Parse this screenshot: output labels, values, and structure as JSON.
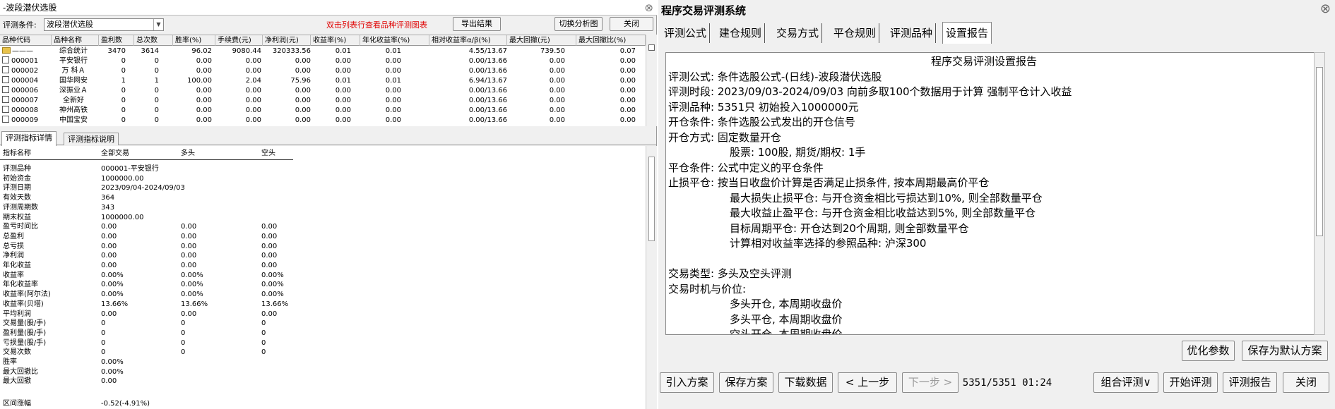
{
  "left": {
    "title": "-波段潜伏选股",
    "cond_label": "评测条件:",
    "cond_value": "波段潜伏选股",
    "hint": "双击列表行查看品种评测图表",
    "export_btn": "导出结果",
    "switch_btn": "切换分析图",
    "close_btn": "关闭",
    "columns": [
      "品种代码",
      "品种名称",
      "盈利数",
      "总次数",
      "胜率(%)",
      "手续费(元)",
      "净利润(元)",
      "收益率(%)",
      "年化收益率(%)",
      "相对收益率α/β(%)",
      "最大回撤(元)",
      "最大回撤比(%)"
    ],
    "rows": [
      {
        "code": "———",
        "name": "综合统计",
        "win": "3470",
        "total": "3614",
        "rate": "96.02",
        "fee": "9080.44",
        "profit": "320333.56",
        "ret": "0.01",
        "annual": "0.01",
        "rel": "4.55/13.67",
        "dd": "739.50",
        "ddr": "0.07"
      },
      {
        "code": "000001",
        "name": "平安银行",
        "win": "0",
        "total": "0",
        "rate": "0.00",
        "fee": "0.00",
        "profit": "0.00",
        "ret": "0.00",
        "annual": "0.00",
        "rel": "0.00/13.66",
        "dd": "0.00",
        "ddr": "0.00"
      },
      {
        "code": "000002",
        "name": "万 科Ａ",
        "win": "0",
        "total": "0",
        "rate": "0.00",
        "fee": "0.00",
        "profit": "0.00",
        "ret": "0.00",
        "annual": "0.00",
        "rel": "0.00/13.66",
        "dd": "0.00",
        "ddr": "0.00"
      },
      {
        "code": "000004",
        "name": "国华网安",
        "win": "1",
        "total": "1",
        "rate": "100.00",
        "fee": "2.04",
        "profit": "75.96",
        "ret": "0.01",
        "annual": "0.01",
        "rel": "6.94/13.67",
        "dd": "0.00",
        "ddr": "0.00"
      },
      {
        "code": "000006",
        "name": "深振业Ａ",
        "win": "0",
        "total": "0",
        "rate": "0.00",
        "fee": "0.00",
        "profit": "0.00",
        "ret": "0.00",
        "annual": "0.00",
        "rel": "0.00/13.66",
        "dd": "0.00",
        "ddr": "0.00"
      },
      {
        "code": "000007",
        "name": "全新好",
        "win": "0",
        "total": "0",
        "rate": "0.00",
        "fee": "0.00",
        "profit": "0.00",
        "ret": "0.00",
        "annual": "0.00",
        "rel": "0.00/13.66",
        "dd": "0.00",
        "ddr": "0.00"
      },
      {
        "code": "000008",
        "name": "神州高铁",
        "win": "0",
        "total": "0",
        "rate": "0.00",
        "fee": "0.00",
        "profit": "0.00",
        "ret": "0.00",
        "annual": "0.00",
        "rel": "0.00/13.66",
        "dd": "0.00",
        "ddr": "0.00"
      },
      {
        "code": "000009",
        "name": "中国宝安",
        "win": "0",
        "total": "0",
        "rate": "0.00",
        "fee": "0.00",
        "profit": "0.00",
        "ret": "0.00",
        "annual": "0.00",
        "rel": "0.00/13.66",
        "dd": "0.00",
        "ddr": "0.00"
      }
    ],
    "bottom_tabs": [
      "评测指标详情",
      "评测指标说明"
    ],
    "stats_header": [
      "指标名称",
      "全部交易",
      "多头",
      "空头"
    ],
    "stats": [
      [
        "评测品种",
        "000001-平安银行",
        "",
        ""
      ],
      [
        "初始资金",
        "1000000.00",
        "",
        ""
      ],
      [
        "评测日期",
        "2023/09/04-2024/09/03",
        "",
        ""
      ],
      [
        "有效天数",
        "364",
        "",
        ""
      ],
      [
        "评测周期数",
        "343",
        "",
        ""
      ],
      [
        "期末权益",
        "1000000.00",
        "",
        ""
      ],
      [
        "盈亏时间比",
        "0.00",
        "0.00",
        "0.00"
      ],
      [
        "总盈利",
        "0.00",
        "0.00",
        "0.00"
      ],
      [
        "总亏损",
        "0.00",
        "0.00",
        "0.00"
      ],
      [
        "净利润",
        "0.00",
        "0.00",
        "0.00"
      ],
      [
        "年化收益",
        "0.00",
        "0.00",
        "0.00"
      ],
      [
        "收益率",
        "0.00%",
        "0.00%",
        "0.00%"
      ],
      [
        "年化收益率",
        "0.00%",
        "0.00%",
        "0.00%"
      ],
      [
        "收益率(阿尔法)",
        "0.00%",
        "0.00%",
        "0.00%"
      ],
      [
        "收益率(贝塔)",
        "13.66%",
        "13.66%",
        "13.66%"
      ],
      [
        "平均利润",
        "0.00",
        "0.00",
        "0.00"
      ],
      [
        "交易量(股/手)",
        "0",
        "0",
        "0"
      ],
      [
        "盈利量(股/手)",
        "0",
        "0",
        "0"
      ],
      [
        "亏损量(股/手)",
        "0",
        "0",
        "0"
      ],
      [
        "交易次数",
        "0",
        "0",
        "0"
      ],
      [
        "胜率",
        "0.00%",
        "",
        ""
      ],
      [
        "最大回撤比",
        "0.00%",
        "",
        ""
      ],
      [
        "最大回撤",
        "0.00",
        "",
        ""
      ],
      [
        "",
        "",
        " ",
        ""
      ],
      [
        "区间涨幅",
        "-0.52(-4.91%)",
        "",
        ""
      ]
    ]
  },
  "right": {
    "title": "程序交易评测系统",
    "tabs": [
      "评测公式",
      "建仓规则",
      "交易方式",
      "平仓规则",
      "评测品种",
      "设置报告"
    ],
    "report": [
      {
        "t": "程序交易评测设置报告",
        "center": true
      },
      {
        "t": "评测公式: 条件选股公式-(日线)-波段潜伏选股"
      },
      {
        "t": "评测时段: 2023/09/03-2024/09/03 向前多取100个数据用于计算 强制平仓计入收益"
      },
      {
        "t": "评测品种: 5351只  初始投入1000000元"
      },
      {
        "t": "开仓条件: 条件选股公式发出的开仓信号"
      },
      {
        "t": "开仓方式: 固定数量开仓"
      },
      {
        "t": "股票: 100股, 期货/期权: 1手",
        "indent": true
      },
      {
        "t": "平仓条件: 公式中定义的平仓条件"
      },
      {
        "t": "止损平仓: 按当日收盘价计算是否满足止损条件, 按本周期最高价平仓"
      },
      {
        "t": "最大损失止损平仓: 与开仓资金相比亏损达到10%, 则全部数量平仓",
        "indent": true
      },
      {
        "t": "最大收益止盈平仓: 与开仓资金相比收益达到5%, 则全部数量平仓",
        "indent": true
      },
      {
        "t": "目标周期平仓: 开仓达到20个周期, 则全部数量平仓",
        "indent": true
      },
      {
        "t": "计算相对收益率选择的参照品种: 沪深300",
        "indent": true
      },
      {
        "t": ""
      },
      {
        "t": "交易类型: 多头及空头评测"
      },
      {
        "t": "交易时机与价位:"
      },
      {
        "t": "多头开仓, 本周期收盘价",
        "indent": true
      },
      {
        "t": "多头平仓, 本周期收盘价",
        "indent": true
      },
      {
        "t": "空头开仓, 本周期收盘价",
        "indent": true
      }
    ],
    "optimize_btn": "优化参数",
    "save_default_btn": "保存为默认方案",
    "import_btn": "引入方案",
    "save_btn": "保存方案",
    "download_btn": "下载数据",
    "prev_btn": "< 上一步",
    "next_btn": "下一步 >",
    "progress": "5351/5351  01:24",
    "combo_btn": "组合评测∨",
    "start_btn": "开始评测",
    "report_btn": "评测报告",
    "close_btn": "关闭"
  }
}
